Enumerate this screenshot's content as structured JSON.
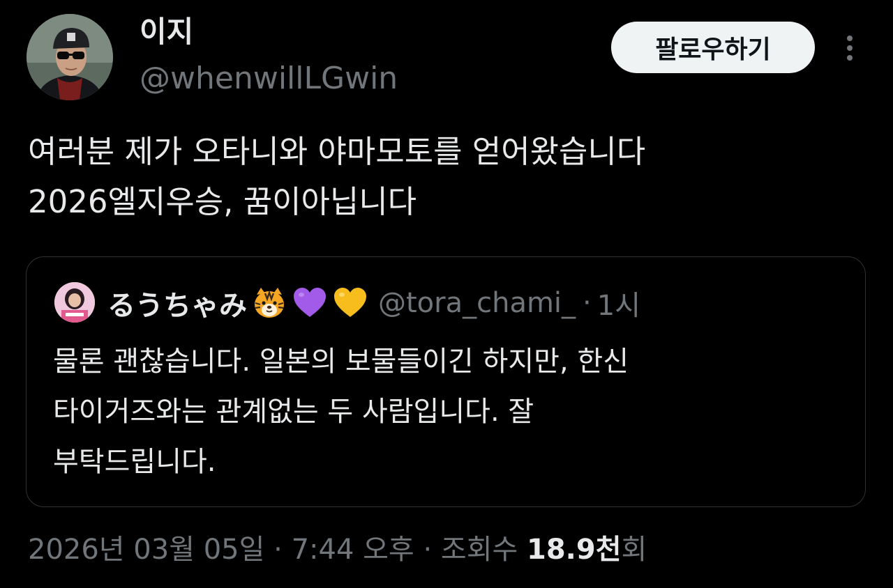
{
  "author": {
    "name": "이지",
    "handle": "@whenwillLGwin"
  },
  "follow_button": {
    "label": "팔로우하기"
  },
  "more_icon": "more-vertical-icon",
  "tweet": {
    "lines": [
      "여러분 제가 오타니와 야마모토를 얻어왔습니다",
      "2026엘지우승, 꿈이아닙니다"
    ]
  },
  "quote": {
    "name": "るうちゃみ",
    "emojis": [
      "tiger-face-icon",
      "purple-heart-icon",
      "yellow-heart-icon"
    ],
    "handle": "@tora_chami_",
    "separator": "·",
    "time": "1시",
    "lines": [
      "물론 괜찮습니다. 일본의 보물들이긴 하지만, 한신",
      "타이거즈와는 관계없는 두 사람입니다. 잘",
      "부탁드립니다."
    ]
  },
  "meta": {
    "date": "2026년 03월 05일",
    "sep1": "·",
    "time": "7:44 오후",
    "sep2": "·",
    "views_label": "조회수",
    "views_count": "18.9천",
    "views_suffix": "회"
  },
  "colors": {
    "background": "#000000",
    "text_primary": "#e7e9ea",
    "text_secondary": "#71767b",
    "border": "#2f3336",
    "button_bg": "#eff3f4",
    "button_text": "#0f1419"
  }
}
